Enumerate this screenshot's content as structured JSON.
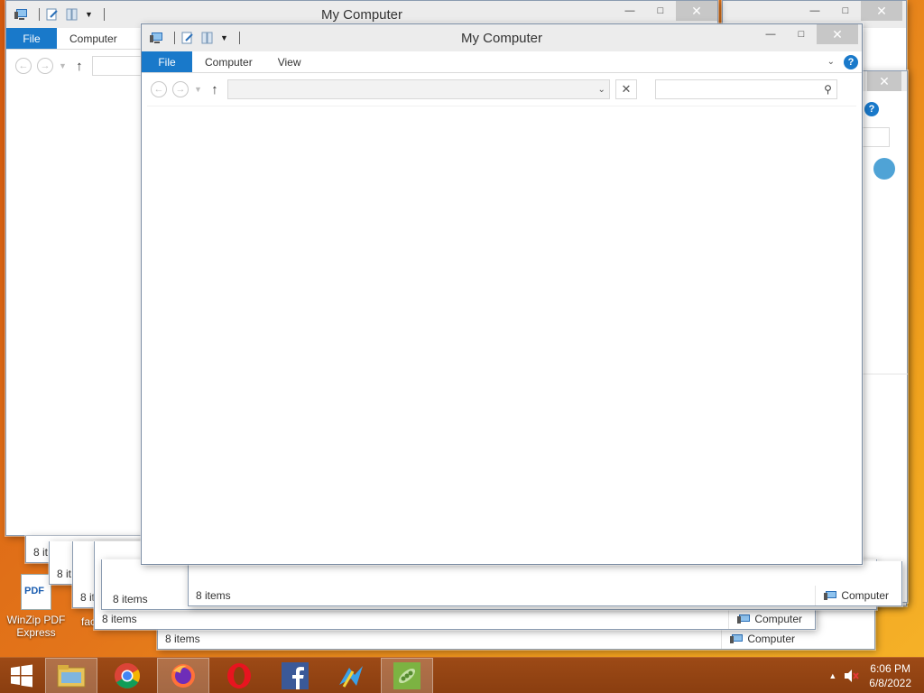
{
  "desktop": {
    "icons": [
      {
        "label": "WinZip PDF Express",
        "glyph_text": "PDF",
        "icon": "pdf-icon"
      },
      {
        "label": "fac",
        "icon": "shortcut-icon"
      }
    ]
  },
  "window_main": {
    "title": "My Computer",
    "ribbon_tabs": [
      "File",
      "Computer",
      "View"
    ],
    "address": "",
    "search_placeholder": "",
    "status_items": "8 items",
    "help": "?"
  },
  "window_back_left": {
    "title": "My Computer",
    "ribbon_tabs": [
      "File",
      "Computer"
    ],
    "status_items": "8 it"
  },
  "stacked_windows": [
    {
      "status_items": "8 it",
      "status_location": ""
    },
    {
      "status_items": "8 it",
      "status_location": ""
    },
    {
      "status_items": "8 it",
      "status_location": ""
    },
    {
      "status_items": "8 items",
      "status_location": "Computer"
    },
    {
      "status_items": "8 items",
      "status_location": "Computer"
    },
    {
      "status_items": "8 items",
      "status_location": "Computer"
    },
    {
      "status_items": "8 items",
      "status_location": ""
    }
  ],
  "taskbar": {
    "apps": [
      {
        "name": "file-explorer",
        "active": true
      },
      {
        "name": "chrome",
        "active": false
      },
      {
        "name": "firefox",
        "active": true
      },
      {
        "name": "opera",
        "active": false
      },
      {
        "name": "facebook",
        "active": false
      },
      {
        "name": "winzip-tool",
        "active": false
      },
      {
        "name": "peazip",
        "active": true
      }
    ],
    "time": "6:06 PM",
    "date": "6/8/2022",
    "show_hidden_icons": "▲"
  },
  "colors": {
    "file_tab": "#1979ca",
    "taskbar": "#8a3e10",
    "desktop": "#e3751a"
  }
}
